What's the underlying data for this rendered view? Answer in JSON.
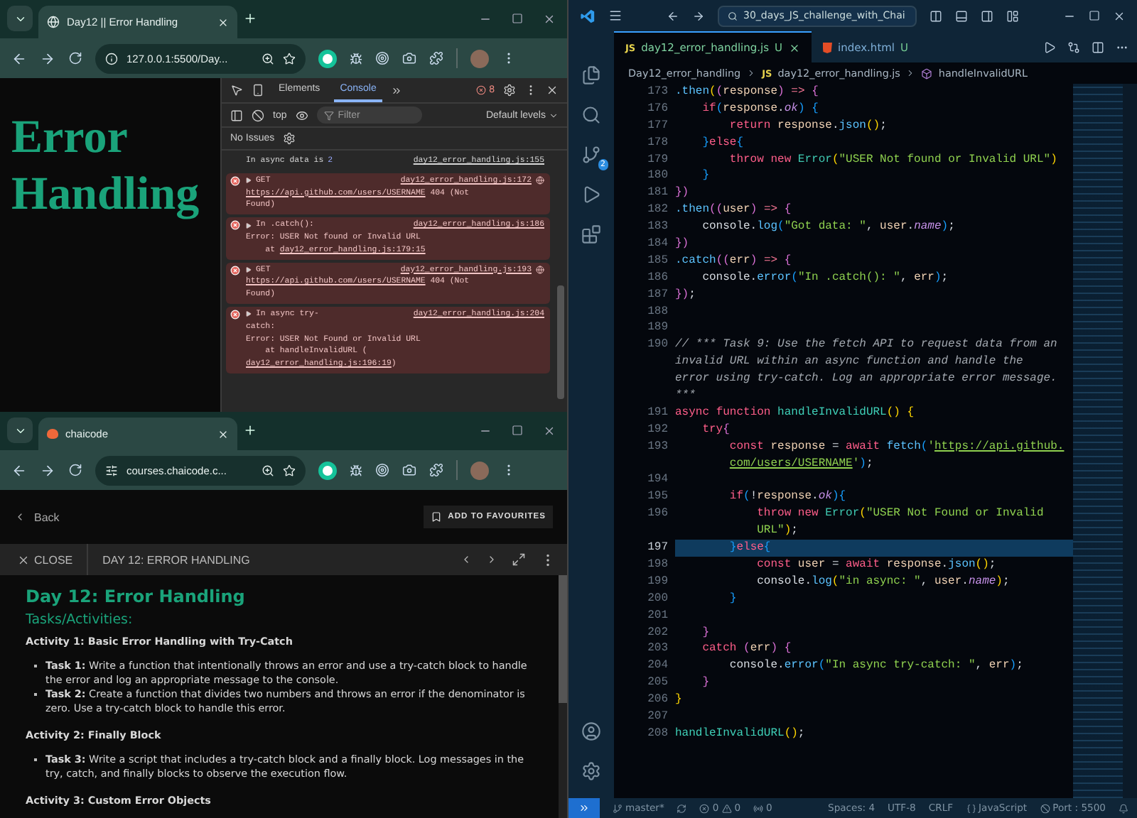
{
  "browser_top": {
    "tab": {
      "title": "Day12 || Error Handling"
    },
    "address": "127.0.0.1:5500/Day...",
    "page": {
      "heading": "Error Handling"
    },
    "devtools": {
      "tabs": [
        {
          "label": "Elements",
          "selected": false
        },
        {
          "label": "Console",
          "selected": true
        }
      ],
      "error_count": "8",
      "context": "top",
      "filter_placeholder": "Filter",
      "levels": "Default levels",
      "issues": "No Issues",
      "messages": [
        {
          "kind": "log",
          "head": "In async data is",
          "value": "2",
          "source": "day12_error_handling.js:155",
          "network": false
        },
        {
          "kind": "error",
          "head": "GET",
          "source": "day12_error_handling.js:172",
          "network": true,
          "lines": [
            [
              {
                "text": "https://api.github.com/users/USERNAME",
                "link": true
              },
              {
                "text": " 404 (Not",
                "link": false
              }
            ],
            [
              {
                "text": "Found)",
                "link": false
              }
            ]
          ]
        },
        {
          "kind": "error",
          "head": "In .catch():",
          "source": "day12_error_handling.js:186",
          "network": false,
          "lines": [
            [
              {
                "text": "Error: USER Not found or Invalid URL",
                "link": false
              }
            ],
            [
              {
                "text": "    at ",
                "link": false
              },
              {
                "text": "day12_error_handling.js:179:15",
                "link": true
              }
            ]
          ]
        },
        {
          "kind": "error",
          "head": "GET",
          "source": "day12_error_handling.js:193",
          "network": true,
          "lines": [
            [
              {
                "text": "https://api.github.com/users/USERNAME",
                "link": true
              },
              {
                "text": " 404 (Not",
                "link": false
              }
            ],
            [
              {
                "text": "Found)",
                "link": false
              }
            ]
          ]
        },
        {
          "kind": "error",
          "head": "In async try-",
          "source": "day12_error_handling.js:204",
          "network": false,
          "lines": [
            [
              {
                "text": "catch:",
                "link": false
              }
            ],
            [
              {
                "text": "Error: USER Not Found or Invalid URL",
                "link": false
              }
            ],
            [
              {
                "text": "    at handleInvalidURL (",
                "link": false
              }
            ],
            [
              {
                "text": "day12_error_handling.js:196:19",
                "link": true
              },
              {
                "text": ")",
                "link": false
              }
            ]
          ]
        }
      ]
    }
  },
  "browser_bottom": {
    "tab": {
      "title": "chaicode"
    },
    "address": "courses.chaicode.c...",
    "back": "Back",
    "favourite": "ADD TO FAVOURITES",
    "close": "CLOSE",
    "lesson": "DAY 12: ERROR HANDLING",
    "content": [
      {
        "kind": "h1",
        "text": "Day 12: Error Handling"
      },
      {
        "kind": "h2",
        "text": "Tasks/Activities:"
      },
      {
        "kind": "h3",
        "text": "Activity 1: Basic Error Handling with Try-Catch"
      },
      {
        "kind": "bullet",
        "text": "**Task 1:** Write a function that intentionally throws an error and use a try-catch block to handle the error and log an appropriate message to the console."
      },
      {
        "kind": "bullet",
        "text": "**Task 2:** Create a function that divides two numbers and throws an error if the denominator is zero. Use a try-catch block to handle this error."
      },
      {
        "kind": "h3",
        "text": "Activity 2: Finally Block"
      },
      {
        "kind": "bullet",
        "text": "**Task 3:** Write a script that includes a try-catch block and a finally block. Log messages in the try, catch, and finally blocks to observe the execution flow."
      },
      {
        "kind": "h3",
        "text": "Activity 3: Custom Error Objects"
      }
    ]
  },
  "editor": {
    "search": "30_days_JS_challenge_with_Chai",
    "scm_badge": "2",
    "tabs": [
      {
        "kind": "js",
        "badge": "JS",
        "label": "day12_error_handling.js",
        "status": "U",
        "selected": true
      },
      {
        "kind": "html",
        "label": "index.html",
        "status": "U",
        "selected": false
      }
    ],
    "breadcrumb": [
      {
        "kind": "folder",
        "text": "Day12_error_handling"
      },
      {
        "kind": "file",
        "badge": "JS",
        "text": "day12_error_handling.js"
      },
      {
        "kind": "symbol",
        "text": "handleInvalidURL"
      }
    ],
    "lines": [
      {
        "kind": "line",
        "num": "173",
        "current": false,
        "tokens": [
          {
            "kind": "fn",
            "text": ".then"
          },
          {
            "kind": "b1",
            "text": "("
          },
          {
            "kind": "b2",
            "text": "("
          },
          {
            "kind": "var",
            "text": "response"
          },
          {
            "kind": "b2",
            "text": ")"
          },
          {
            "kind": "op",
            "text": " => "
          },
          {
            "kind": "b2",
            "text": "{"
          }
        ]
      },
      {
        "kind": "line",
        "num": "176",
        "current": false,
        "tokens": [
          {
            "kind": "kw",
            "text": "    if"
          },
          {
            "kind": "b3",
            "text": "("
          },
          {
            "kind": "var",
            "text": "response"
          },
          {
            "kind": "pl",
            "text": "."
          },
          {
            "kind": "prop",
            "text": "ok"
          },
          {
            "kind": "b3",
            "text": ")"
          },
          {
            "kind": "b3",
            "text": " {"
          }
        ]
      },
      {
        "kind": "line",
        "num": "177",
        "current": false,
        "tokens": [
          {
            "kind": "kw",
            "text": "        return"
          },
          {
            "kind": "var",
            "text": " response"
          },
          {
            "kind": "pl",
            "text": "."
          },
          {
            "kind": "fn",
            "text": "json"
          },
          {
            "kind": "b1",
            "text": "()"
          },
          {
            "kind": "pl",
            "text": ";"
          }
        ]
      },
      {
        "kind": "line",
        "num": "178",
        "current": false,
        "tokens": [
          {
            "kind": "b3",
            "text": "    }"
          },
          {
            "kind": "kw",
            "text": "else"
          },
          {
            "kind": "b3",
            "text": "{"
          }
        ]
      },
      {
        "kind": "line",
        "num": "179",
        "current": false,
        "tokens": [
          {
            "kind": "kw",
            "text": "        throw new"
          },
          {
            "kind": "cls",
            "text": " Error"
          },
          {
            "kind": "b1",
            "text": "("
          },
          {
            "kind": "str",
            "text": "\"USER Not found or Invalid URL\""
          },
          {
            "kind": "b1",
            "text": ")"
          }
        ]
      },
      {
        "kind": "line",
        "num": "180",
        "current": false,
        "tokens": [
          {
            "kind": "b3",
            "text": "    }"
          }
        ]
      },
      {
        "kind": "line",
        "num": "181",
        "current": false,
        "tokens": [
          {
            "kind": "b2",
            "text": "})"
          }
        ]
      },
      {
        "kind": "line",
        "num": "182",
        "current": false,
        "tokens": [
          {
            "kind": "fn",
            "text": ".then"
          },
          {
            "kind": "b2",
            "text": "(("
          },
          {
            "kind": "var",
            "text": "user"
          },
          {
            "kind": "b2",
            "text": ")"
          },
          {
            "kind": "op",
            "text": " => "
          },
          {
            "kind": "b2",
            "text": "{"
          }
        ]
      },
      {
        "kind": "line",
        "num": "183",
        "current": false,
        "tokens": [
          {
            "kind": "pl",
            "text": "    console."
          },
          {
            "kind": "fn",
            "text": "log"
          },
          {
            "kind": "b3",
            "text": "("
          },
          {
            "kind": "str",
            "text": "\"Got data: \""
          },
          {
            "kind": "pl",
            "text": ", "
          },
          {
            "kind": "var",
            "text": "user"
          },
          {
            "kind": "pl",
            "text": "."
          },
          {
            "kind": "prop",
            "text": "name"
          },
          {
            "kind": "b3",
            "text": ")"
          },
          {
            "kind": "pl",
            "text": ";"
          }
        ]
      },
      {
        "kind": "line",
        "num": "184",
        "current": false,
        "tokens": [
          {
            "kind": "b2",
            "text": "})"
          }
        ]
      },
      {
        "kind": "line",
        "num": "185",
        "current": false,
        "tokens": [
          {
            "kind": "fn",
            "text": ".catch"
          },
          {
            "kind": "b2",
            "text": "(("
          },
          {
            "kind": "var",
            "text": "err"
          },
          {
            "kind": "b2",
            "text": ")"
          },
          {
            "kind": "op",
            "text": " => "
          },
          {
            "kind": "b2",
            "text": "{"
          }
        ]
      },
      {
        "kind": "line",
        "num": "186",
        "current": false,
        "tokens": [
          {
            "kind": "pl",
            "text": "    console."
          },
          {
            "kind": "fn",
            "text": "error"
          },
          {
            "kind": "b3",
            "text": "("
          },
          {
            "kind": "str",
            "text": "\"In .catch(): \""
          },
          {
            "kind": "pl",
            "text": ", "
          },
          {
            "kind": "var",
            "text": "err"
          },
          {
            "kind": "b3",
            "text": ")"
          },
          {
            "kind": "pl",
            "text": ";"
          }
        ]
      },
      {
        "kind": "line",
        "num": "187",
        "current": false,
        "tokens": [
          {
            "kind": "b2",
            "text": "})"
          },
          {
            "kind": "pl",
            "text": ";"
          }
        ]
      },
      {
        "kind": "line",
        "num": "188",
        "current": false
      },
      {
        "kind": "line",
        "num": "189",
        "current": false
      },
      {
        "kind": "line",
        "num": "190",
        "current": false,
        "tokens": [
          {
            "kind": "cmt",
            "text": "// *** Task 9: Use the fetch API to request data from an"
          }
        ]
      },
      {
        "kind": "wrap",
        "current": false,
        "tokens": [
          {
            "kind": "cmt",
            "text": "invalid URL within an async function and handle the"
          }
        ]
      },
      {
        "kind": "wrap",
        "current": false,
        "tokens": [
          {
            "kind": "cmt",
            "text": "error using try-catch. Log an appropriate error message."
          }
        ]
      },
      {
        "kind": "wrap",
        "current": false,
        "tokens": [
          {
            "kind": "cmt",
            "text": "***"
          }
        ]
      },
      {
        "kind": "line",
        "num": "191",
        "current": false,
        "tokens": [
          {
            "kind": "kw",
            "text": "async"
          },
          {
            "kind": "kw",
            "text": " function"
          },
          {
            "kind": "def",
            "text": " handleInvalidURL"
          },
          {
            "kind": "b1",
            "text": "()"
          },
          {
            "kind": "b1",
            "text": " {"
          }
        ]
      },
      {
        "kind": "line",
        "num": "192",
        "current": false,
        "tokens": [
          {
            "kind": "kw",
            "text": "    try"
          },
          {
            "kind": "b2",
            "text": "{"
          }
        ]
      },
      {
        "kind": "line",
        "num": "193",
        "current": false,
        "tokens": [
          {
            "kind": "kw",
            "text": "        const"
          },
          {
            "kind": "var",
            "text": " response"
          },
          {
            "kind": "pl",
            "text": " = "
          },
          {
            "kind": "kw",
            "text": "await"
          },
          {
            "kind": "fn",
            "text": " fetch"
          },
          {
            "kind": "b3",
            "text": "("
          },
          {
            "kind": "str",
            "text": "'"
          },
          {
            "kind": "url",
            "text": "https://api.github."
          }
        ]
      },
      {
        "kind": "wrap",
        "current": false,
        "tokens": [
          {
            "kind": "url",
            "text": "        com/users/USERNAME"
          },
          {
            "kind": "str",
            "text": "'"
          },
          {
            "kind": "b3",
            "text": ")"
          },
          {
            "kind": "pl",
            "text": ";"
          }
        ]
      },
      {
        "kind": "line",
        "num": "194",
        "current": false
      },
      {
        "kind": "line",
        "num": "195",
        "current": false,
        "tokens": [
          {
            "kind": "kw",
            "text": "        if"
          },
          {
            "kind": "b3",
            "text": "("
          },
          {
            "kind": "pl",
            "text": "!"
          },
          {
            "kind": "var",
            "text": "response"
          },
          {
            "kind": "pl",
            "text": "."
          },
          {
            "kind": "prop",
            "text": "ok"
          },
          {
            "kind": "b3",
            "text": ")"
          },
          {
            "kind": "b3",
            "text": "{"
          }
        ]
      },
      {
        "kind": "line",
        "num": "196",
        "current": false,
        "tokens": [
          {
            "kind": "kw",
            "text": "            throw new"
          },
          {
            "kind": "cls",
            "text": " Error"
          },
          {
            "kind": "b1",
            "text": "("
          },
          {
            "kind": "str",
            "text": "\"USER Not Found or Invalid"
          }
        ]
      },
      {
        "kind": "wrap",
        "current": false,
        "tokens": [
          {
            "kind": "str",
            "text": "            URL\""
          },
          {
            "kind": "b1",
            "text": ")"
          },
          {
            "kind": "pl",
            "text": ";"
          }
        ]
      },
      {
        "kind": "line",
        "num": "197",
        "current": true,
        "tokens": [
          {
            "kind": "b3",
            "text": "        }"
          },
          {
            "kind": "kw",
            "text": "else"
          },
          {
            "kind": "b3",
            "text": "{"
          }
        ]
      },
      {
        "kind": "line",
        "num": "198",
        "current": false,
        "tokens": [
          {
            "kind": "kw",
            "text": "            const"
          },
          {
            "kind": "var",
            "text": " user"
          },
          {
            "kind": "pl",
            "text": " = "
          },
          {
            "kind": "kw",
            "text": "await"
          },
          {
            "kind": "var",
            "text": " response"
          },
          {
            "kind": "pl",
            "text": "."
          },
          {
            "kind": "fn",
            "text": "json"
          },
          {
            "kind": "b1",
            "text": "()"
          },
          {
            "kind": "pl",
            "text": ";"
          }
        ]
      },
      {
        "kind": "line",
        "num": "199",
        "current": false,
        "tokens": [
          {
            "kind": "pl",
            "text": "            console."
          },
          {
            "kind": "fn",
            "text": "log"
          },
          {
            "kind": "b1",
            "text": "("
          },
          {
            "kind": "str",
            "text": "\"in async: \""
          },
          {
            "kind": "pl",
            "text": ", "
          },
          {
            "kind": "var",
            "text": "user"
          },
          {
            "kind": "pl",
            "text": "."
          },
          {
            "kind": "prop",
            "text": "name"
          },
          {
            "kind": "b1",
            "text": ")"
          },
          {
            "kind": "pl",
            "text": ";"
          }
        ]
      },
      {
        "kind": "line",
        "num": "200",
        "current": false,
        "tokens": [
          {
            "kind": "b3",
            "text": "        }"
          }
        ]
      },
      {
        "kind": "line",
        "num": "201",
        "current": false
      },
      {
        "kind": "line",
        "num": "202",
        "current": false,
        "tokens": [
          {
            "kind": "b2",
            "text": "    }"
          }
        ]
      },
      {
        "kind": "line",
        "num": "203",
        "current": false,
        "tokens": [
          {
            "kind": "kw",
            "text": "    catch"
          },
          {
            "kind": "b2",
            "text": " ("
          },
          {
            "kind": "var",
            "text": "err"
          },
          {
            "kind": "b2",
            "text": ")"
          },
          {
            "kind": "b2",
            "text": " {"
          }
        ]
      },
      {
        "kind": "line",
        "num": "204",
        "current": false,
        "tokens": [
          {
            "kind": "pl",
            "text": "        console."
          },
          {
            "kind": "fn",
            "text": "error"
          },
          {
            "kind": "b3",
            "text": "("
          },
          {
            "kind": "str",
            "text": "\"In async try-catch: \""
          },
          {
            "kind": "pl",
            "text": ", "
          },
          {
            "kind": "var",
            "text": "err"
          },
          {
            "kind": "b3",
            "text": ")"
          },
          {
            "kind": "pl",
            "text": ";"
          }
        ]
      },
      {
        "kind": "line",
        "num": "205",
        "current": false,
        "tokens": [
          {
            "kind": "b2",
            "text": "    }"
          }
        ]
      },
      {
        "kind": "line",
        "num": "206",
        "current": false,
        "tokens": [
          {
            "kind": "b1",
            "text": "}"
          }
        ]
      },
      {
        "kind": "line",
        "num": "207",
        "current": false
      },
      {
        "kind": "line",
        "num": "208",
        "current": false,
        "tokens": [
          {
            "kind": "def",
            "text": "handleInvalidURL"
          },
          {
            "kind": "b1",
            "text": "()"
          },
          {
            "kind": "pl",
            "text": ";"
          }
        ]
      }
    ],
    "status_bar": {
      "branch": "master*",
      "errors": "0",
      "warnings": "0",
      "ports": "0",
      "spaces": "Spaces: 4",
      "encoding": "UTF-8",
      "eol": "CRLF",
      "language": "JavaScript",
      "port": "Port : 5500"
    }
  }
}
